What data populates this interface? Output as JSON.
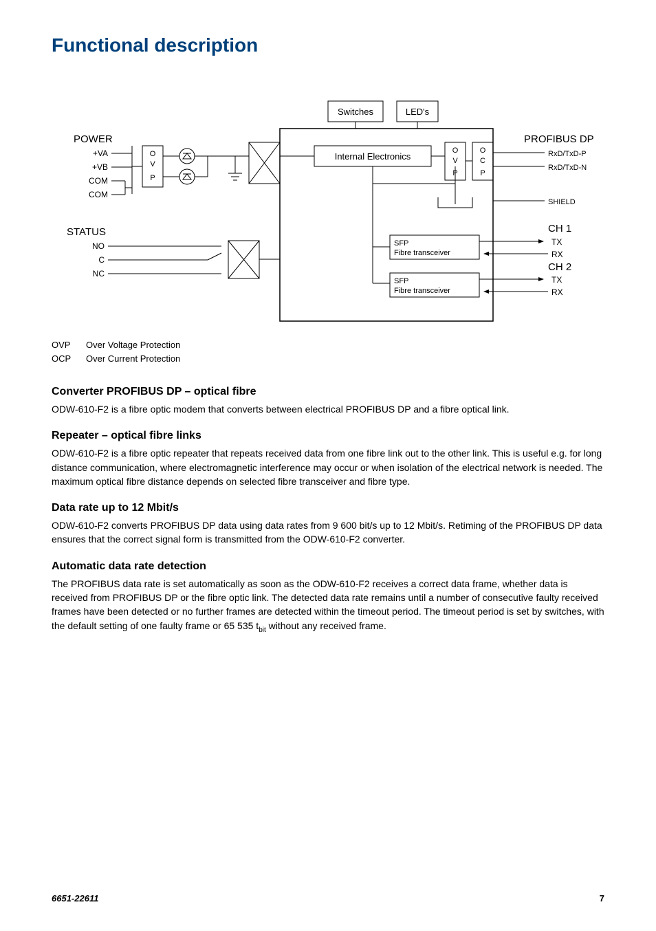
{
  "title": "Functional description",
  "diagram": {
    "switches": "Switches",
    "leds": "LED's",
    "power_label": "POWER",
    "power": {
      "va": "+VA",
      "vb": "+VB",
      "com1": "COM",
      "com2": "COM"
    },
    "status_label": "STATUS",
    "status": {
      "no": "NO",
      "c": "C",
      "nc": "NC"
    },
    "ovp": {
      "o": "O",
      "v": "V",
      "p": "P"
    },
    "internal": "Internal Electronics",
    "ocp": {
      "o": "O",
      "c": "C",
      "p": "P"
    },
    "profibus_label": "PROFIBUS DP",
    "profibus": {
      "rxp": "RxD/TxD-P",
      "rxn": "RxD/TxD-N",
      "shield": "SHIELD"
    },
    "sfp": "SFP",
    "fibre": "Fibre transceiver",
    "ch1": "CH 1",
    "ch2": "CH 2",
    "tx": "TX",
    "rx": "RX"
  },
  "legend": {
    "ovp_abbr": "OVP",
    "ovp_text": "Over Voltage Protection",
    "ocp_abbr": "OCP",
    "ocp_text": "Over Current Protection"
  },
  "sections": {
    "s1_title": "Converter PROFIBUS DP – optical fibre",
    "s1_text": "ODW-610-F2 is a fibre optic modem that converts between electrical PROFIBUS DP and a fibre optical link.",
    "s2_title": "Repeater – optical fibre links",
    "s2_text": "ODW-610-F2 is a fibre optic repeater that repeats received data from one fibre link out to the other link. This is useful e.g. for long distance communication, where electromagnetic interference  may occur or when isolation of the electrical network is needed. The maximum optical fibre distance depends on selected fibre transceiver and fibre type.",
    "s3_title": "Data rate up to 12 Mbit/s",
    "s3_text": "ODW-610-F2 converts PROFIBUS DP data using data rates from 9 600 bit/s up to 12 Mbit/s. Retiming of the PROFIBUS DP data ensures that the correct signal form is transmitted from the ODW-610-F2 converter.",
    "s4_title": "Automatic data rate detection",
    "s4_text_a": "The PROFIBUS data rate is set automatically as soon as the ODW-610-F2 receives a correct data frame, whether data is received from PROFIBUS DP or the fibre optic link. The detected data rate remains until a number of consecutive faulty received frames have been detected or no further frames are detected within the timeout period.  The timeout period is set by switches, with the default setting of one faulty frame or 65 535 t",
    "s4_sub": "bit",
    "s4_text_b": " without any received frame."
  },
  "footer": {
    "doc": "6651-22611",
    "page": "7"
  }
}
